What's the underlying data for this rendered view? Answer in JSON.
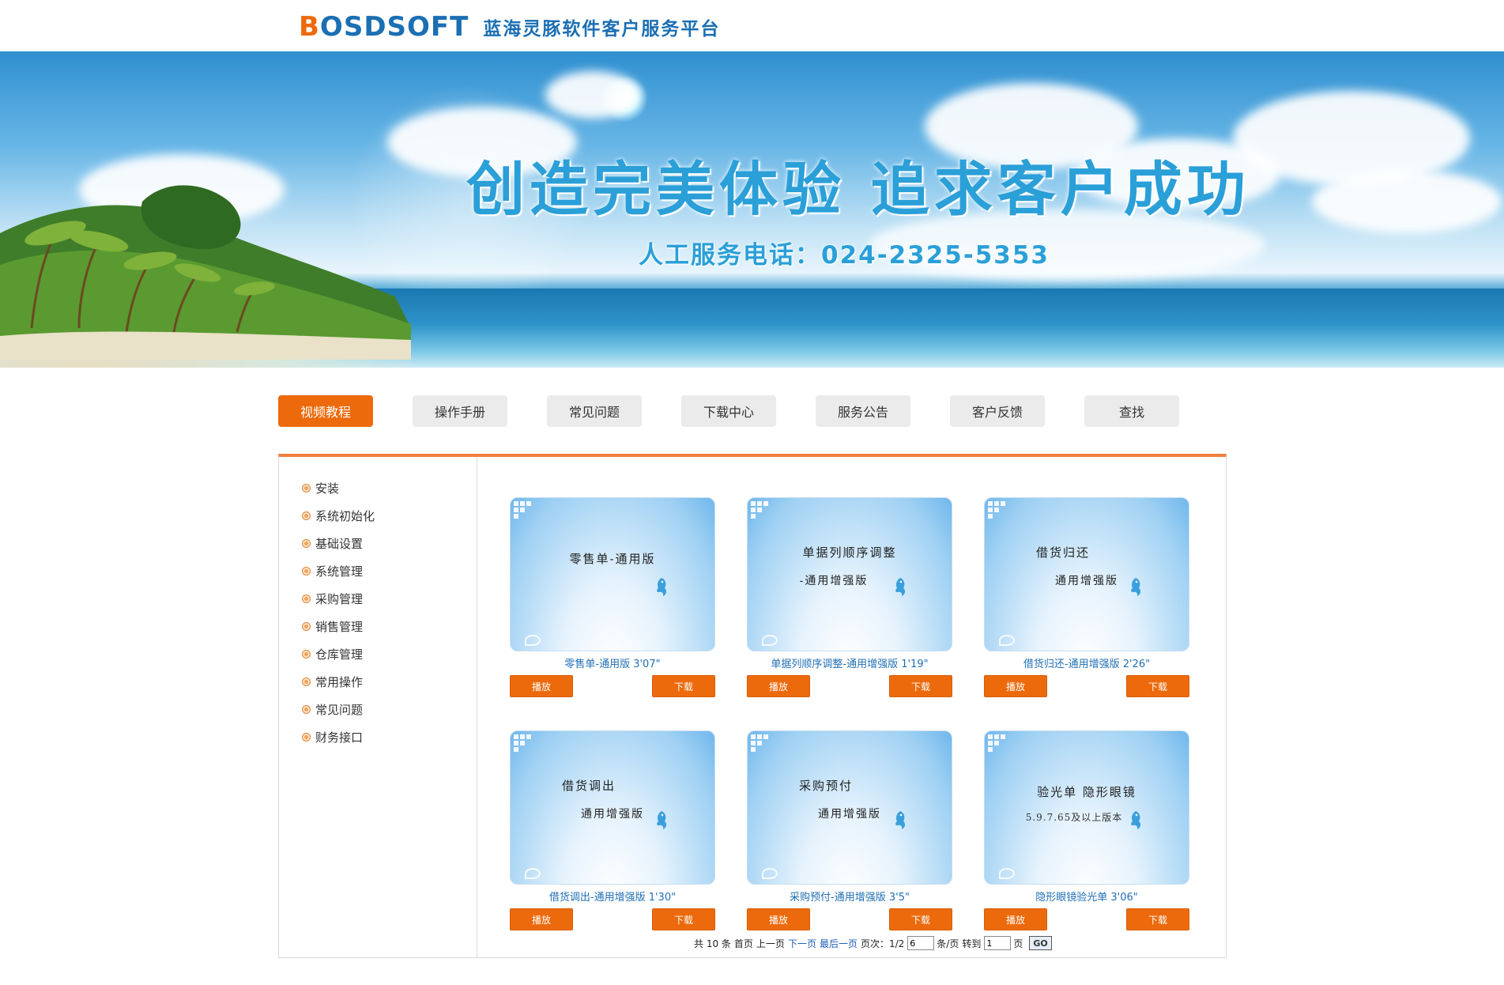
{
  "header": {
    "logo": {
      "b": "B",
      "rest": "OSDSOFT"
    },
    "title": "蓝海灵豚软件客户服务平台"
  },
  "banner": {
    "slogan": "创造完美体验  追求客户成功",
    "phone": "人工服务电话：024-2325-5353"
  },
  "tabs": [
    {
      "label": "视频教程",
      "active": true
    },
    {
      "label": "操作手册",
      "active": false
    },
    {
      "label": "常见问题",
      "active": false
    },
    {
      "label": "下载中心",
      "active": false
    },
    {
      "label": "服务公告",
      "active": false
    },
    {
      "label": "客户反馈",
      "active": false
    },
    {
      "label": "查找",
      "active": false
    }
  ],
  "sidebar": {
    "items": [
      "安装",
      "系统初始化",
      "基础设置",
      "系统管理",
      "采购管理",
      "销售管理",
      "仓库管理",
      "常用操作",
      "常见问题",
      "财务接口"
    ]
  },
  "videos": [
    {
      "thumb_line1": "零售单-通用版",
      "thumb_line2": "",
      "thumb_small": "",
      "caption": "零售单-通用版 3'07\"",
      "play": "播放",
      "download": "下载"
    },
    {
      "thumb_line1": "单据列顺序调整",
      "thumb_line2": "-通用增强版",
      "thumb_small": "",
      "caption": "单据列顺序调整-通用增强版 1'19\"",
      "play": "播放",
      "download": "下载"
    },
    {
      "thumb_line1": "借货归还",
      "thumb_line2": "通用增强版",
      "thumb_small": "",
      "caption": "借货归还-通用增强版 2'26\"",
      "play": "播放",
      "download": "下载"
    },
    {
      "thumb_line1": "借货调出",
      "thumb_line2": "通用增强版",
      "thumb_small": "",
      "caption": "借货调出-通用增强版 1'30\"",
      "play": "播放",
      "download": "下载"
    },
    {
      "thumb_line1": "采购预付",
      "thumb_line2": "通用增强版",
      "thumb_small": "",
      "caption": "采购预付-通用增强版 3'5\"",
      "play": "播放",
      "download": "下载"
    },
    {
      "thumb_line1": "验光单  隐形眼镜",
      "thumb_line2": "",
      "thumb_small": "5.9.7.65及以上版本",
      "caption": "隐形眼镜验光单 3'06\"",
      "play": "播放",
      "download": "下载"
    }
  ],
  "pager": {
    "total": "共 10 条",
    "first": "首页",
    "prev": "上一页",
    "next": "下一页",
    "last": "最后一页",
    "page_label": "页次：1/2",
    "per_page_value": "6",
    "per_page_unit": "条/页",
    "goto_label": "转到",
    "goto_value": "1",
    "page_unit": "页",
    "go": "GO"
  },
  "colors": {
    "accent": "#ec6a0c",
    "brand_blue": "#1b6fb3",
    "link": "#1f6fb5"
  }
}
